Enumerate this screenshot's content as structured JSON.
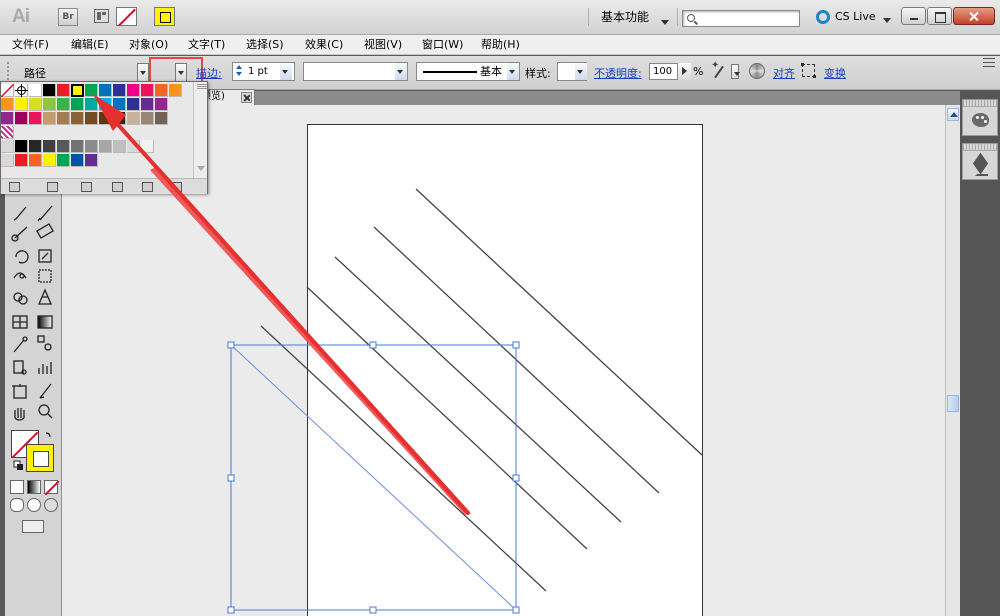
{
  "app": {
    "logo": "Ai",
    "bridge_button": "Br",
    "workspace": "基本功能",
    "search_placeholder": "",
    "cs_live": "CS Live"
  },
  "menu": {
    "items": [
      "文件(F)",
      "编辑(E)",
      "对象(O)",
      "文字(T)",
      "选择(S)",
      "效果(C)",
      "视图(V)",
      "窗口(W)",
      "帮助(H)"
    ]
  },
  "control_bar": {
    "object_type": "路径",
    "stroke_label": "描边:",
    "stroke_weight": "1 pt",
    "profile_label": "基本",
    "style_label": "样式:",
    "opacity_label": "不透明度:",
    "opacity_value": "100",
    "percent": "%",
    "align_label": "对齐",
    "transform_label": "变换"
  },
  "document": {
    "tab_label": "预览)"
  },
  "colors": {
    "accent_red": "#e64545",
    "stroke_yellow": "#fff200",
    "selection_blue": "#4a78d8",
    "none_red": "#d0102b"
  },
  "swatches": {
    "row1": [
      "none",
      "registration",
      "#ffffff",
      "#000000",
      "#ed1c24",
      "#fff200",
      "#00a651",
      "#0072bc",
      "#2e3192",
      "#ec008c",
      "#ed145b",
      "#f26522",
      "#f7941d"
    ],
    "row2": [
      "#f7941d",
      "#fff200",
      "#d7df23",
      "#8dc63f",
      "#39b54a",
      "#00a651",
      "#00a99d",
      "#00aeef",
      "#0072bc",
      "#2e3192",
      "#662d91",
      "#92278f"
    ],
    "row3": [
      "#92278f",
      "#9e005d",
      "#ed145b",
      "#c69c6d",
      "#a67c52",
      "#8c6239",
      "#754c24",
      "#603813",
      "#42210b",
      "#c7b299",
      "#998675",
      "#736357"
    ],
    "grays": [
      "#000000",
      "#262626",
      "#404040",
      "#595959",
      "#737373",
      "#8c8c8c",
      "#a6a6a6",
      "#bfbfbf",
      "#d9d9d9",
      "#f2f2f2"
    ],
    "brights": [
      "#ed1c24",
      "#f26522",
      "#fff200",
      "#00a651",
      "#0054a6",
      "#662d91"
    ]
  }
}
